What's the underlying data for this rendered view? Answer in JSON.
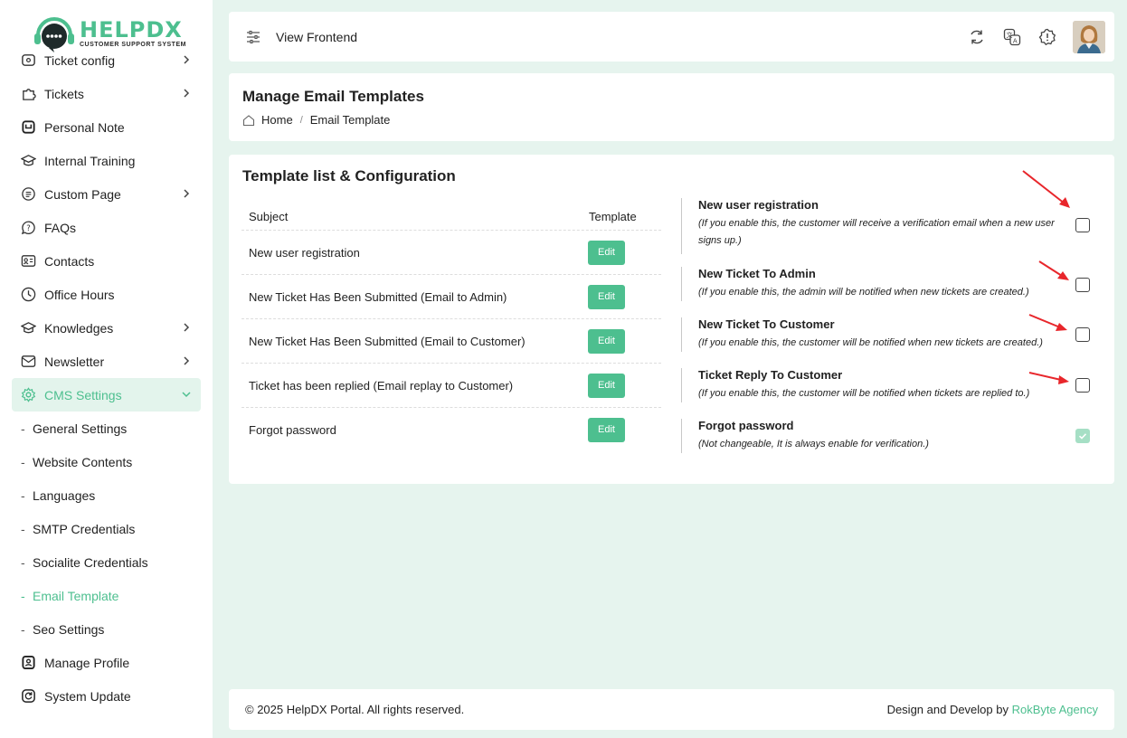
{
  "brand": {
    "name": "HELPDX",
    "tagline": "CUSTOMER SUPPORT SYSTEM"
  },
  "sidebar": {
    "items": [
      {
        "label": "Ticket config",
        "icon": "ticket-config-icon",
        "has_children": true
      },
      {
        "label": "Tickets",
        "icon": "puzzle-icon",
        "has_children": true
      },
      {
        "label": "Personal Note",
        "icon": "note-icon",
        "has_children": false
      },
      {
        "label": "Internal Training",
        "icon": "graduation-icon",
        "has_children": false
      },
      {
        "label": "Custom Page",
        "icon": "page-icon",
        "has_children": true
      },
      {
        "label": "FAQs",
        "icon": "faq-icon",
        "has_children": false
      },
      {
        "label": "Contacts",
        "icon": "contact-card-icon",
        "has_children": false
      },
      {
        "label": "Office Hours",
        "icon": "clock-icon",
        "has_children": false
      },
      {
        "label": "Knowledges",
        "icon": "knowledge-icon",
        "has_children": true
      },
      {
        "label": "Newsletter",
        "icon": "newsletter-icon",
        "has_children": true
      },
      {
        "label": "CMS Settings",
        "icon": "gear-icon",
        "has_children": true,
        "expanded": true
      }
    ],
    "cms_sub_items": [
      "General Settings",
      "Website Contents",
      "Languages",
      "SMTP Credentials",
      "Socialite Credentials",
      "Email Template",
      "Seo Settings"
    ],
    "current_sub_item": "Email Template",
    "bottom_items": [
      {
        "label": "Manage Profile",
        "icon": "profile-icon"
      },
      {
        "label": "System Update",
        "icon": "refresh-icon"
      }
    ]
  },
  "topbar": {
    "view_frontend": "View Frontend"
  },
  "header": {
    "title": "Manage Email Templates",
    "breadcrumb": {
      "home": "Home",
      "current": "Email Template"
    }
  },
  "main": {
    "section_title": "Template list & Configuration",
    "table": {
      "col_subject": "Subject",
      "col_template": "Template",
      "edit_label": "Edit",
      "rows": [
        "New user registration",
        "New Ticket Has Been Submitted (Email to Admin)",
        "New Ticket Has Been Submitted (Email to Customer)",
        "Ticket has been replied (Email replay to Customer)",
        "Forgot password"
      ]
    },
    "config": [
      {
        "title": "New user registration",
        "desc": "(If you enable this, the customer will receive a verification email when a new user signs up.)",
        "checked": false,
        "disabled": false
      },
      {
        "title": "New Ticket To Admin",
        "desc": "(If you enable this, the admin will be notified when new tickets are created.)",
        "checked": false,
        "disabled": false
      },
      {
        "title": "New Ticket To Customer",
        "desc": "(If you enable this, the customer will be notified when new tickets are created.)",
        "checked": false,
        "disabled": false
      },
      {
        "title": "Ticket Reply To Customer",
        "desc": "(If you enable this, the customer will be notified when tickets are replied to.)",
        "checked": false,
        "disabled": false
      },
      {
        "title": "Forgot password",
        "desc": "(Not changeable, It is always enable for verification.)",
        "checked": true,
        "disabled": true
      }
    ]
  },
  "footer": {
    "copyright": "© 2025 HelpDX Portal. All rights reserved.",
    "credit_prefix": "Design and Develop by",
    "credit_link": "RokByte Agency"
  },
  "colors": {
    "accent": "#4dbf8f",
    "background": "#e6f4ee",
    "annotation_arrow": "#e8262b"
  }
}
